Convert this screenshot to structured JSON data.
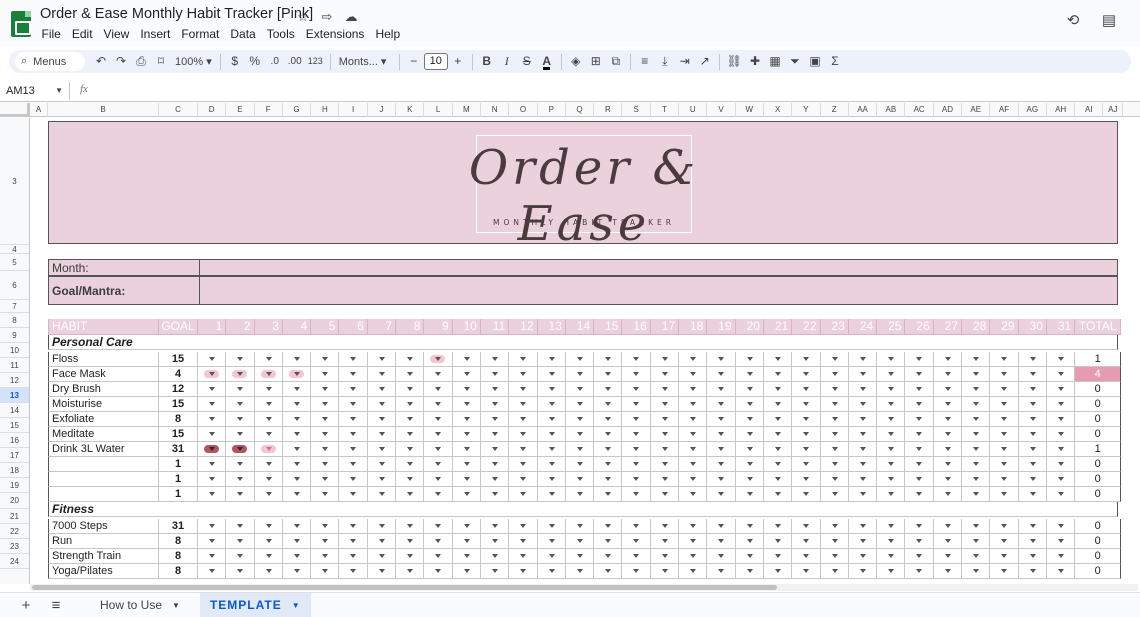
{
  "app": {
    "title": "Order & Ease Monthly Habit Tracker [Pink]",
    "menu": [
      "File",
      "Edit",
      "View",
      "Insert",
      "Format",
      "Data",
      "Tools",
      "Extensions",
      "Help"
    ]
  },
  "toolbar": {
    "search_placeholder": "Menus",
    "zoom": "100%",
    "currency": "$",
    "percent": "%",
    "dec_decrease": ".0",
    "dec_increase": ".00",
    "number_format": "123",
    "font": "Monts...",
    "font_size": "10",
    "bold": "B",
    "italic": "I",
    "strike": "S",
    "text_color": "A"
  },
  "formula_bar": {
    "name_box": "AM13",
    "fx": "fx",
    "value": ""
  },
  "columns": [
    "A",
    "B",
    "C",
    "D",
    "E",
    "F",
    "G",
    "H",
    "I",
    "J",
    "K",
    "L",
    "M",
    "N",
    "O",
    "P",
    "Q",
    "R",
    "S",
    "T",
    "U",
    "V",
    "W",
    "X",
    "Y",
    "Z",
    "AA",
    "AB",
    "AC",
    "AD",
    "AE",
    "AF",
    "AG",
    "AH",
    "AI",
    "AJ"
  ],
  "rows": [
    "3",
    "4",
    "5",
    "6",
    "7",
    "8",
    "9",
    "10",
    "11",
    "12",
    "13",
    "14",
    "15",
    "16",
    "17",
    "18",
    "19",
    "20",
    "21",
    "22",
    "23",
    "24"
  ],
  "selected_row": "13",
  "banner": {
    "title": "Order & Ease",
    "subtitle": "MONTHLY HABIT TRACKER"
  },
  "info": {
    "month_label": "Month:",
    "goal_label": "Goal/Mantra:"
  },
  "header": {
    "habit": "HABIT",
    "goal": "GOAL",
    "days": [
      "1",
      "2",
      "3",
      "4",
      "5",
      "6",
      "7",
      "8",
      "9",
      "10",
      "11",
      "12",
      "13",
      "14",
      "15",
      "16",
      "17",
      "18",
      "19",
      "20",
      "21",
      "22",
      "23",
      "24",
      "25",
      "26",
      "27",
      "28",
      "29",
      "30",
      "31"
    ],
    "total": "TOTAL"
  },
  "sections": [
    {
      "title": "Personal Care",
      "habits": [
        {
          "name": "Floss",
          "goal": "15",
          "total": "1",
          "marks": {
            "9": "pink"
          }
        },
        {
          "name": "Face Mask",
          "goal": "4",
          "total": "4",
          "highlight": true,
          "marks": {
            "1": "pink",
            "2": "pink",
            "3": "pink",
            "4": "pink"
          }
        },
        {
          "name": "Dry Brush",
          "goal": "12",
          "total": "0",
          "marks": {}
        },
        {
          "name": "Moisturise",
          "goal": "15",
          "total": "0",
          "marks": {}
        },
        {
          "name": "Exfoliate",
          "goal": "8",
          "total": "0",
          "marks": {}
        },
        {
          "name": "Meditate",
          "goal": "15",
          "total": "0",
          "marks": {}
        },
        {
          "name": "Drink 3L Water",
          "goal": "31",
          "total": "1",
          "marks": {
            "1": "red",
            "2": "red",
            "3": "lpink"
          }
        },
        {
          "name": "",
          "goal": "1",
          "total": "0",
          "marks": {}
        },
        {
          "name": "",
          "goal": "1",
          "total": "0",
          "marks": {}
        },
        {
          "name": "",
          "goal": "1",
          "total": "0",
          "marks": {}
        }
      ]
    },
    {
      "title": "Fitness",
      "habits": [
        {
          "name": "7000 Steps",
          "goal": "31",
          "total": "0",
          "marks": {}
        },
        {
          "name": "Run",
          "goal": "8",
          "total": "0",
          "marks": {}
        },
        {
          "name": "Strength Train",
          "goal": "8",
          "total": "0",
          "marks": {}
        },
        {
          "name": "Yoga/Pilates",
          "goal": "8",
          "total": "0",
          "marks": {}
        }
      ]
    }
  ],
  "sheet_tabs": [
    {
      "label": "How to Use",
      "active": false
    },
    {
      "label": "TEMPLATE",
      "active": true
    }
  ],
  "colors": {
    "pink_bg": "#ead1dc",
    "checkbox_pink": "#f4c6d2",
    "checkbox_red": "#b5545e",
    "total_highlight": "#e79bb1",
    "sheets_green": "#188038"
  }
}
